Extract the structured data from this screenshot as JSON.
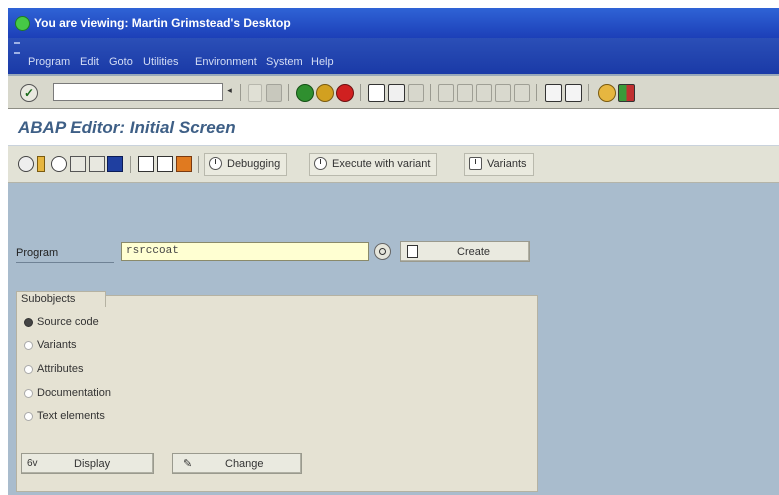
{
  "window": {
    "title": "You are viewing: Martin Grimstead's Desktop"
  },
  "menubar": {
    "items": [
      "Program",
      "Edit",
      "Goto",
      "Utilities",
      "Environment",
      "System",
      "Help"
    ]
  },
  "standard_toolbar": {
    "command_field_value": "",
    "icons": [
      "enter-icon",
      "save-icon",
      "back-icon",
      "exit-icon",
      "cancel-icon",
      "print-icon",
      "find-icon",
      "find-next-icon",
      "first-page-icon",
      "previous-page-icon",
      "next-page-icon",
      "last-page-icon",
      "create-session-icon",
      "shortcut-icon",
      "help-icon",
      "layout-icon"
    ]
  },
  "screen": {
    "title": "ABAP Editor: Initial Screen"
  },
  "app_toolbar": {
    "debugging_label": "Debugging",
    "execute_variant_label": "Execute with variant",
    "variants_label": "Variants"
  },
  "program": {
    "label": "Program",
    "value": "rsrccoat",
    "create_label": "Create"
  },
  "subobjects": {
    "title": "Subobjects",
    "options": [
      {
        "label": "Source code",
        "selected": true
      },
      {
        "label": "Variants",
        "selected": false
      },
      {
        "label": "Attributes",
        "selected": false
      },
      {
        "label": "Documentation",
        "selected": false
      },
      {
        "label": "Text elements",
        "selected": false
      }
    ]
  },
  "actions": {
    "display_label": "Display",
    "change_label": "Change"
  }
}
